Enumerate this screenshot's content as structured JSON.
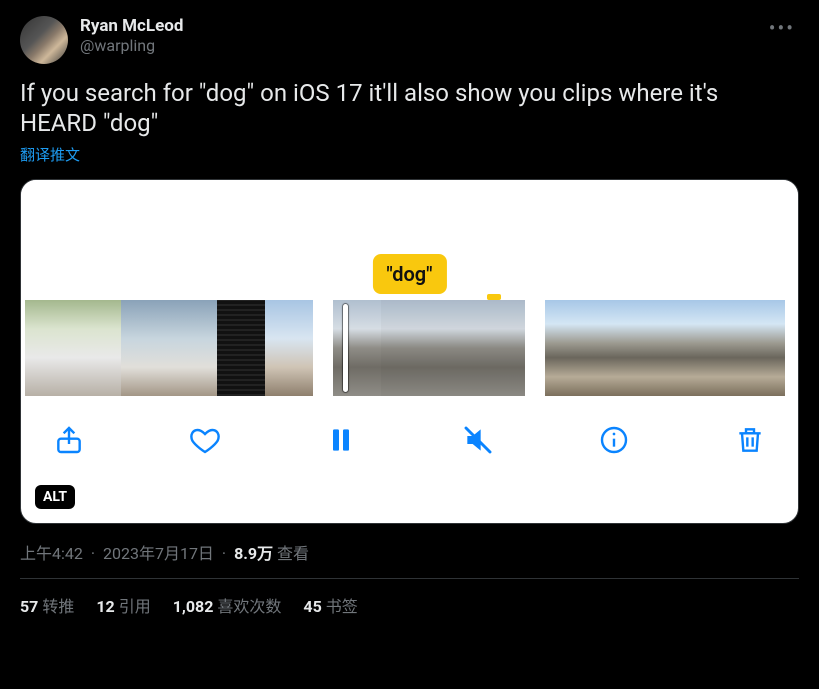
{
  "author": {
    "display_name": "Ryan McLeod",
    "username": "@warpling"
  },
  "tweet_text": "If you search for \"dog\" on iOS 17 it'll also show you clips where it's HEARD \"dog\"",
  "translate_label": "翻译推文",
  "media": {
    "highlight_term": "\"dog\"",
    "alt_label": "ALT"
  },
  "meta": {
    "time": "上午4:42",
    "date": "2023年7月17日",
    "views_value": "8.9万",
    "views_label": "查看"
  },
  "stats": {
    "retweets": {
      "value": "57",
      "label": "转推"
    },
    "quotes": {
      "value": "12",
      "label": "引用"
    },
    "likes": {
      "value": "1,082",
      "label": "喜欢次数"
    },
    "bookmarks": {
      "value": "45",
      "label": "书签"
    }
  }
}
